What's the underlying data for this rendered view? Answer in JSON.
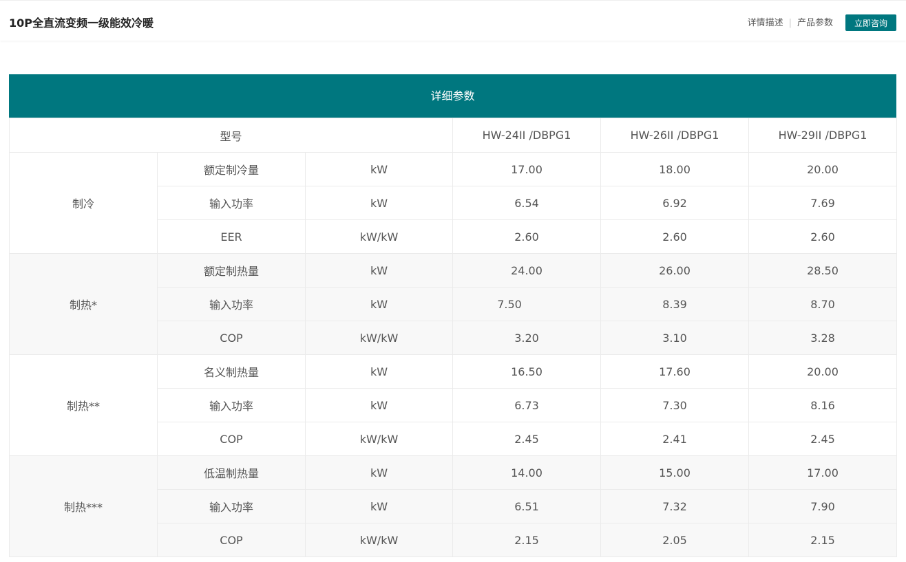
{
  "header": {
    "title": "10P全直流变频一级能效冷暖",
    "nav": [
      "详情描述",
      "产品参数"
    ],
    "nav_separator": "|",
    "consult_button": "立即咨询"
  },
  "colors": {
    "accent": "#00777f",
    "row_alt": "#f8f8f8",
    "text": "#555555"
  },
  "table": {
    "title": "详细参数",
    "model_label": "型号",
    "models": [
      "HW-24II /DBPG1",
      "HW-26II /DBPG1",
      "HW-29II /DBPG1"
    ],
    "groups": [
      {
        "name": "制冷",
        "rows": [
          {
            "param": "额定制冷量",
            "unit": "kW",
            "values": [
              "17.00",
              "18.00",
              "20.00"
            ]
          },
          {
            "param": "输入功率",
            "unit": "kW",
            "values": [
              "6.54",
              "6.92",
              "7.69"
            ]
          },
          {
            "param": "EER",
            "unit": "kW/kW",
            "values": [
              "2.60",
              "2.60",
              "2.60"
            ]
          }
        ]
      },
      {
        "name": "制热*",
        "rows": [
          {
            "param": "额定制热量",
            "unit": "kW",
            "values": [
              "24.00",
              "26.00",
              "28.50"
            ]
          },
          {
            "param": "输入功率",
            "unit": "kW",
            "values": [
              "7.50",
              "8.39",
              "8.70"
            ]
          },
          {
            "param": "COP",
            "unit": "kW/kW",
            "values": [
              "3.20",
              "3.10",
              "3.28"
            ]
          }
        ]
      },
      {
        "name": "制热**",
        "rows": [
          {
            "param": "名义制热量",
            "unit": "kW",
            "values": [
              "16.50",
              "17.60",
              "20.00"
            ]
          },
          {
            "param": "输入功率",
            "unit": "kW",
            "values": [
              "6.73",
              "7.30",
              "8.16"
            ]
          },
          {
            "param": "COP",
            "unit": "kW/kW",
            "values": [
              "2.45",
              "2.41",
              "2.45"
            ]
          }
        ]
      },
      {
        "name": "制热***",
        "rows": [
          {
            "param": "低温制热量",
            "unit": "kW",
            "values": [
              "14.00",
              "15.00",
              "17.00"
            ]
          },
          {
            "param": "输入功率",
            "unit": "kW",
            "values": [
              "6.51",
              "7.32",
              "7.90"
            ]
          },
          {
            "param": "COP",
            "unit": "kW/kW",
            "values": [
              "2.15",
              "2.05",
              "2.15"
            ]
          }
        ]
      }
    ]
  }
}
